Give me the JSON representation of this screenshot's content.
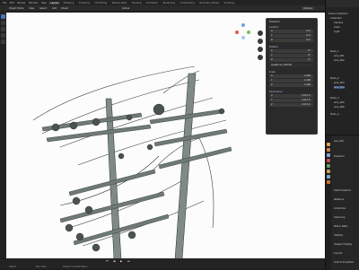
{
  "topbar": {
    "menus": [
      "File",
      "Edit",
      "Render",
      "Window",
      "Help"
    ],
    "workspace_tabs": [
      "Layout",
      "Modeling",
      "Sculpting",
      "UV Editing",
      "Texture Paint",
      "Shading",
      "Animation",
      "Rendering",
      "Compositing",
      "Geometry Nodes",
      "Scripting"
    ],
    "active_tab": "Layout",
    "scene_label": "Scene",
    "view_layer_label": "ViewLayer"
  },
  "viewport": {
    "header_items": [
      "Object Mode",
      "View",
      "Select",
      "Add",
      "Object"
    ],
    "transform_orientation": "Global",
    "options_label": "Options"
  },
  "npanel": {
    "title": "Transform",
    "location_label": "Location:",
    "rotation_label": "Rotation:",
    "quaternion_label": "Quaternion (WXYZ)",
    "scale_label": "Scale:",
    "dimensions_label": "Dimensions:",
    "location": [
      {
        "axis": "X",
        "value": "0 m"
      },
      {
        "axis": "Y",
        "value": "0 m"
      },
      {
        "axis": "Z",
        "value": "0 m"
      }
    ],
    "rotation": [
      {
        "axis": "X",
        "value": "0°"
      },
      {
        "axis": "Y",
        "value": "0°"
      },
      {
        "axis": "Z",
        "value": "0°"
      }
    ],
    "scale": [
      {
        "axis": "X",
        "value": "1.000"
      },
      {
        "axis": "Y",
        "value": "1.000"
      },
      {
        "axis": "Z",
        "value": "1.000"
      }
    ],
    "dimensions": [
      {
        "axis": "X",
        "value": "2.013 m"
      },
      {
        "axis": "Y",
        "value": "2.013 m"
      },
      {
        "axis": "Z",
        "value": "2.013 m"
      }
    ]
  },
  "outliner": {
    "title": "Scene Collection",
    "items": [
      "Collection",
      "Camera",
      "Cube",
      "Light",
      "Node_1",
      "wire_001",
      "wire_002",
      "Node_2",
      "wire_003",
      "wire_004",
      "Node_3",
      "wire_005",
      "wire_006",
      "Node_4"
    ]
  },
  "properties": {
    "object_name": "wire_004",
    "sections": [
      "Transform",
      "Delta Transform",
      "Relations",
      "Collections",
      "Instancing",
      "Motion Paths",
      "Visibility",
      "Viewport Display",
      "Line Art",
      "Custom Properties"
    ],
    "icon_colors": [
      "#e0a050",
      "#d08040",
      "#7fa7d9",
      "#c05050",
      "#5fa05f",
      "#d0a050",
      "#7faac8",
      "#d07030"
    ]
  },
  "statusbar": {
    "left_text": "Select",
    "mid_text": "Pan View",
    "right_text": "Object Context Menu",
    "playback_glyphs": [
      "⏮",
      "◀",
      "▶",
      "⏭"
    ]
  }
}
